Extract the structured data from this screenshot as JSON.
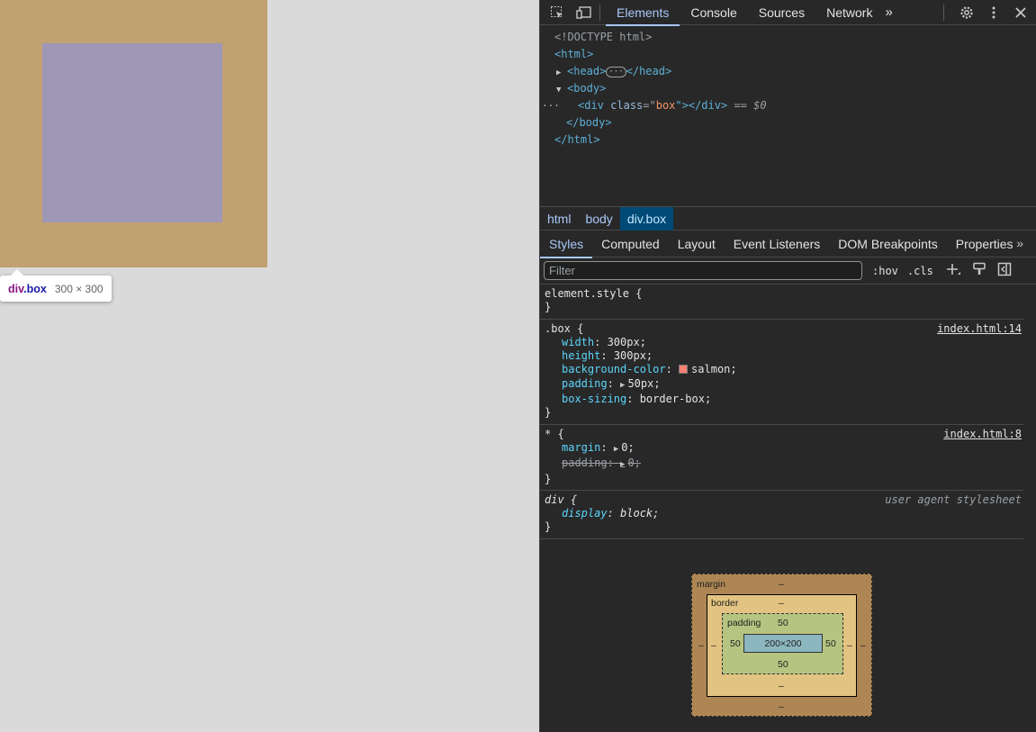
{
  "page": {
    "tooltip": {
      "tag": "div",
      "class": ".box",
      "size": "300 × 300"
    },
    "colors": {
      "margin_highlight": "#c1a171",
      "content_highlight": "#9e97b5",
      "background": "#dadada"
    }
  },
  "devtools": {
    "toolbar": {
      "inspect_icon": "inspect-element-icon",
      "device_icon": "device-toolbar-icon",
      "tabs": [
        "Elements",
        "Console",
        "Sources",
        "Network"
      ],
      "more_tabs": "»",
      "settings_icon": "gear-icon",
      "menu_icon": "kebab-menu-icon",
      "close_icon": "close-icon"
    },
    "dom": {
      "doctype": "<!DOCTYPE html>",
      "html_open": "<html>",
      "head_open": "<head>",
      "head_ellipsis": "···",
      "head_close": "</head>",
      "body_open": "<body>",
      "div_tag_open": "<div",
      "div_attr_name": "class",
      "div_attr_eq": "=\"",
      "div_attr_value": "box",
      "div_attr_end": "\">",
      "div_close": "</div>",
      "selected_marker": "== $0",
      "row_dots": "···",
      "body_close": "</body>",
      "html_close": "</html>"
    },
    "breadcrumbs": [
      "html",
      "body",
      "div.box"
    ],
    "subtabs": [
      "Styles",
      "Computed",
      "Layout",
      "Event Listeners",
      "DOM Breakpoints",
      "Properties"
    ],
    "subtabs_more": "»",
    "filter": {
      "placeholder": "Filter",
      "hov": ":hov",
      "cls": ".cls"
    },
    "styles": {
      "element_style": {
        "selector": "element.style {",
        "close": "}"
      },
      "box_rule": {
        "selector": ".box {",
        "source": "index.html:14",
        "declarations": [
          {
            "name": "width",
            "value": "300px;"
          },
          {
            "name": "height",
            "value": "300px;"
          },
          {
            "name": "background-color",
            "value": "salmon;",
            "swatch": "#fa8072"
          },
          {
            "name": "padding",
            "value": "50px;"
          },
          {
            "name": "box-sizing",
            "value": "border-box;"
          }
        ],
        "close": "}"
      },
      "universal_rule": {
        "selector": "* {",
        "source": "index.html:8",
        "declarations": [
          {
            "name": "margin",
            "value": "0;"
          },
          {
            "name": "padding",
            "value": "0;",
            "overridden": true
          }
        ],
        "close": "}"
      },
      "ua_rule": {
        "selector": "div {",
        "source": "user agent stylesheet",
        "declarations": [
          {
            "name": "display",
            "value": "block;"
          }
        ],
        "close": "}"
      }
    },
    "box_model": {
      "margin_label": "margin",
      "border_label": "border",
      "padding_label": "padding",
      "margin_top": "–",
      "margin_bottom": "–",
      "margin_left": "–",
      "margin_right": "–",
      "border_top": "–",
      "border_bottom": "–",
      "border_left": "–",
      "border_right": "–",
      "padding_top": "50",
      "padding_bottom": "50",
      "padding_left": "50",
      "padding_right": "50",
      "content": "200×200"
    }
  }
}
